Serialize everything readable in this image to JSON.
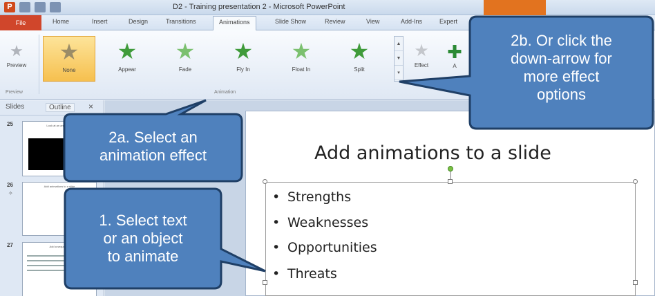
{
  "window": {
    "title": "D2 - Training presentation 2 - Microsoft PowerPoint",
    "app_icon_letter": "P"
  },
  "tabs": [
    {
      "label": "File",
      "active": false
    },
    {
      "label": "Home",
      "active": false
    },
    {
      "label": "Insert",
      "active": false
    },
    {
      "label": "Design",
      "active": false
    },
    {
      "label": "Transitions",
      "active": false
    },
    {
      "label": "Animations",
      "active": true
    },
    {
      "label": "Slide Show",
      "active": false
    },
    {
      "label": "Review",
      "active": false
    },
    {
      "label": "View",
      "active": false
    },
    {
      "label": "Add-Ins",
      "active": false
    },
    {
      "label": "Expert",
      "active": false
    }
  ],
  "ribbon": {
    "preview_label": "Preview",
    "preview_group_label": "Preview",
    "animation_group_label": "Animation",
    "effects": [
      {
        "label": "None",
        "selected": true,
        "icon": "star-icon"
      },
      {
        "label": "Appear",
        "selected": false,
        "icon": "star-icon"
      },
      {
        "label": "Fade",
        "selected": false,
        "icon": "star-icon"
      },
      {
        "label": "Fly In",
        "selected": false,
        "icon": "star-icon"
      },
      {
        "label": "Float In",
        "selected": false,
        "icon": "star-icon"
      },
      {
        "label": "Split",
        "selected": false,
        "icon": "star-icon"
      }
    ],
    "effect_options_label": "Effect",
    "add_animation_label": "A"
  },
  "left_panel": {
    "tabs": [
      "Slides",
      "Outline"
    ],
    "close_glyph": "×",
    "thumbnails": [
      {
        "number": "25",
        "title": "Look at an animation"
      },
      {
        "number": "26",
        "title": "Add animations to a slide"
      },
      {
        "number": "27",
        "title": "Add a sequence"
      }
    ]
  },
  "slide": {
    "title": "Add animations to a slide",
    "bullets": [
      "Strengths",
      "Weaknesses",
      "Opportunities",
      "Threats"
    ]
  },
  "callouts": {
    "c1": [
      "1. Select text",
      "or an object",
      "to animate"
    ],
    "c2a": [
      "2a. Select an",
      "animation effect"
    ],
    "c2b": [
      "2b. Or click the",
      "down-arrow for",
      "more effect",
      "options"
    ]
  },
  "colors": {
    "callout_fill": "#4f81bd",
    "callout_stroke": "#1f3f66",
    "selected_effect": "#f6c04f",
    "file_tab": "#d0462b"
  }
}
